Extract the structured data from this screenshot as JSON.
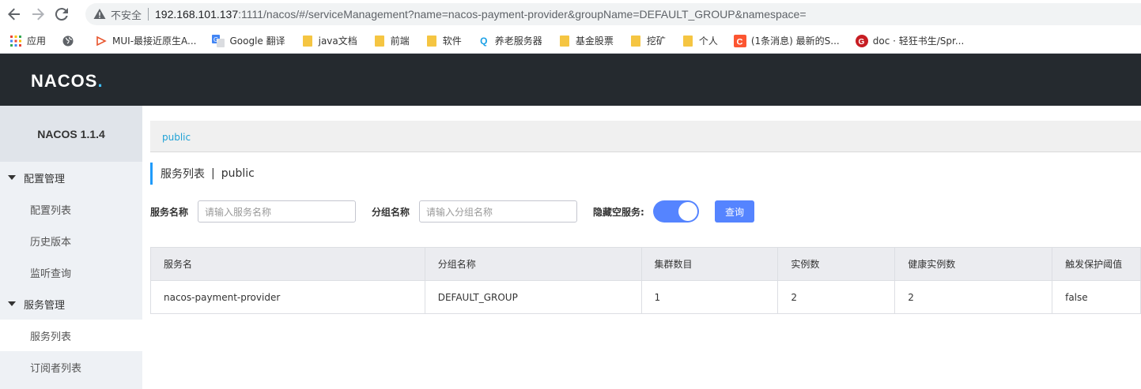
{
  "browser": {
    "insecure_label": "不安全",
    "url_host": "192.168.101.137",
    "url_rest": ":1111/nacos/#/serviceManagement?name=nacos-payment-provider&groupName=DEFAULT_GROUP&namespace=",
    "bookmarks": [
      {
        "label": "应用",
        "icon": "apps-grid-icon"
      },
      {
        "label": "",
        "icon": "globe-icon"
      },
      {
        "label": "MUI-最接近原生A...",
        "icon": "mui-icon"
      },
      {
        "label": "Google 翻译",
        "icon": "google-translate-icon"
      },
      {
        "label": "java文档",
        "icon": "folder-icon"
      },
      {
        "label": "前端",
        "icon": "folder-icon"
      },
      {
        "label": "软件",
        "icon": "folder-icon"
      },
      {
        "label": "养老服务器",
        "icon": "q-icon"
      },
      {
        "label": "基金股票",
        "icon": "folder-icon"
      },
      {
        "label": "挖矿",
        "icon": "folder-icon"
      },
      {
        "label": "个人",
        "icon": "folder-icon"
      },
      {
        "label": "(1条消息) 最新的S...",
        "icon": "csdn-icon"
      },
      {
        "label": "doc · 轻狂书生/Spr...",
        "icon": "gitee-icon"
      }
    ]
  },
  "header": {
    "logo_text": "NACOS",
    "logo_dot": "."
  },
  "sidebar": {
    "title": "NACOS 1.1.4",
    "groups": [
      {
        "label": "配置管理",
        "items": [
          "配置列表",
          "历史版本",
          "监听查询"
        ]
      },
      {
        "label": "服务管理",
        "items": [
          "服务列表",
          "订阅者列表"
        ]
      }
    ]
  },
  "namespace": {
    "current": "public"
  },
  "page": {
    "title": "服务列表",
    "pipe": "|",
    "namespace": "public"
  },
  "filters": {
    "service_name_label": "服务名称",
    "service_name_placeholder": "请输入服务名称",
    "group_name_label": "分组名称",
    "group_name_placeholder": "请输入分组名称",
    "hide_empty_label": "隐藏空服务:",
    "hide_empty_on": true,
    "query_button": "查询"
  },
  "table": {
    "headers": [
      "服务名",
      "分组名称",
      "集群数目",
      "实例数",
      "健康实例数",
      "触发保护阈值"
    ],
    "rows": [
      [
        "nacos-payment-provider",
        "DEFAULT_GROUP",
        "1",
        "2",
        "2",
        "false"
      ]
    ]
  },
  "colors": {
    "accent": "#5584ff",
    "topbar": "#252a2f",
    "link": "#1fa2d6"
  }
}
